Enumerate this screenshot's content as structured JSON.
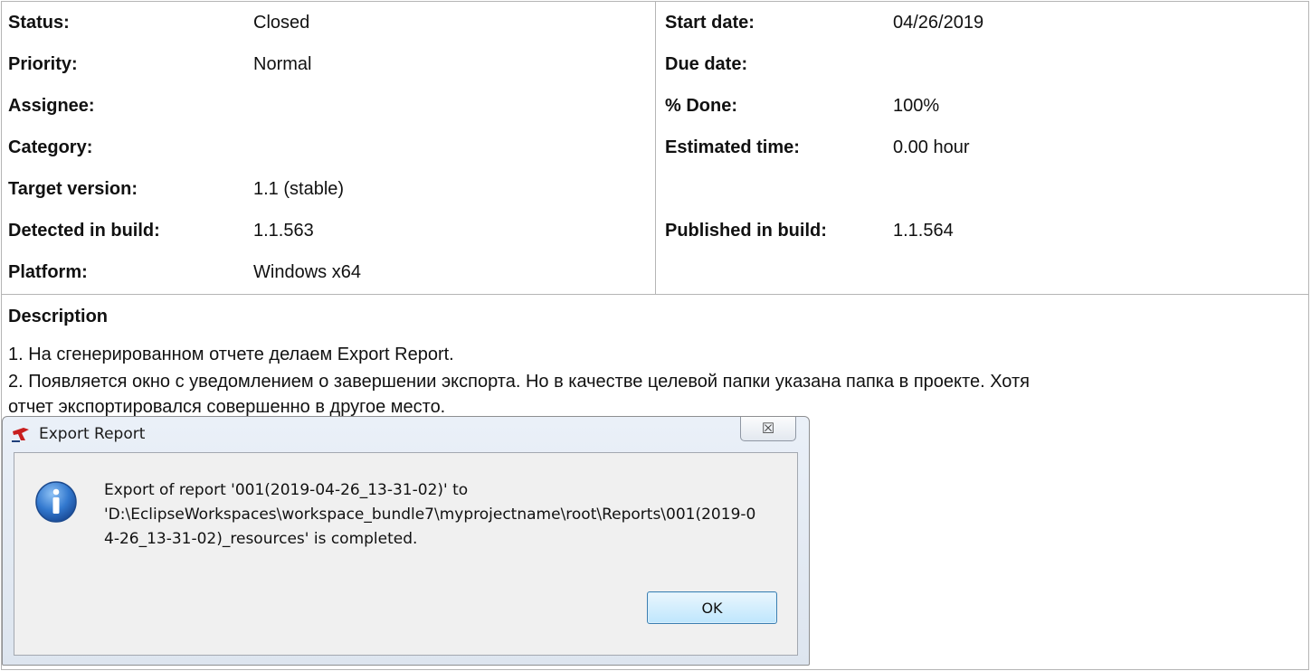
{
  "attributes_left": [
    {
      "label": "Status:",
      "value": "Closed"
    },
    {
      "label": "Priority:",
      "value": "Normal"
    },
    {
      "label": "Assignee:",
      "value": ""
    },
    {
      "label": "Category:",
      "value": ""
    },
    {
      "label": "Target version:",
      "value": "1.1 (stable)"
    },
    {
      "label": "Detected in build:",
      "value": "1.1.563"
    },
    {
      "label": "Platform:",
      "value": "Windows x64"
    }
  ],
  "attributes_right": [
    {
      "label": "Start date:",
      "value": "04/26/2019"
    },
    {
      "label": "Due date:",
      "value": ""
    },
    {
      "label": "% Done:",
      "value": "100%"
    },
    {
      "label": "Estimated time:",
      "value": "0.00 hour"
    },
    {
      "label": "",
      "value": ""
    },
    {
      "label": "Published in build:",
      "value": "1.1.564"
    }
  ],
  "description": {
    "title": "Description",
    "lines": [
      "1. На сгенерированном отчете делаем Export Report.",
      "2. Появляется окно с уведомлением о завершении экспорта. Но в качестве целевой папки указана папка в проекте. Хотя",
      "отчет экспортировался совершенно в другое место."
    ]
  },
  "dialog": {
    "title": "Export Report",
    "close_label": "☒",
    "message_lines": [
      "Export of report '001(2019-04-26_13-31-02)' to",
      "'D:\\EclipseWorkspaces\\workspace_bundle7\\myprojectname\\root\\Reports\\001(2019-0",
      "4-26_13-31-02)_resources' is completed."
    ],
    "ok_label": "OK",
    "info_glyph": "i",
    "icons": {
      "logo": "app-logo-icon",
      "info": "info-icon",
      "close": "close-icon"
    }
  },
  "colors": {
    "border": "#b5b5b5",
    "info_blue": "#2f6fbf"
  }
}
